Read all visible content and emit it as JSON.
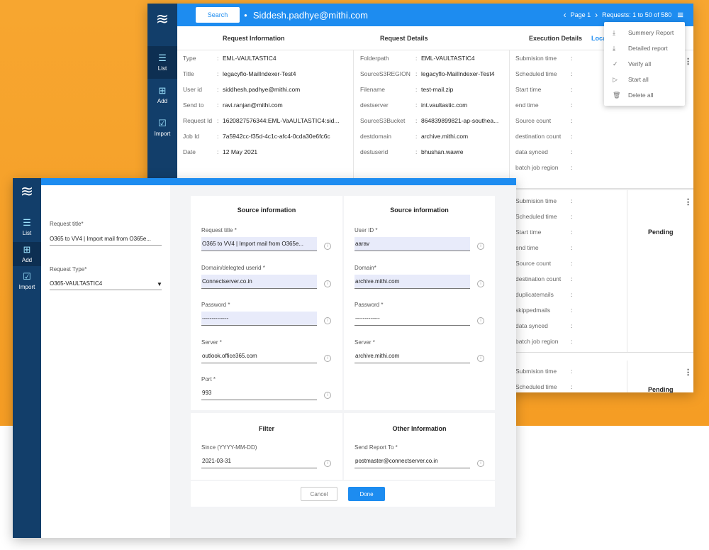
{
  "back": {
    "nav": [
      {
        "label": "List",
        "icon": "list-icon"
      },
      {
        "label": "Add",
        "icon": "add-icon"
      },
      {
        "label": "Import",
        "icon": "import-icon"
      }
    ],
    "search_label": "Search",
    "user_email": "Siddesh.padhye@mithi.com",
    "pager": {
      "page": "Page 1",
      "requests": "Requests: 1 to 50 of 580"
    },
    "headers": {
      "request_info": "Request Information",
      "request_details": "Request Details",
      "execution_details": "Execution Details",
      "cut": "Loca"
    },
    "request_info": [
      {
        "k": "Type",
        "v": "EML-VAULTASTIC4"
      },
      {
        "k": "Title",
        "v": "legacyflo-MailIndexer-Test4"
      },
      {
        "k": "User id",
        "v": "siddhesh.padhye@mithi.com"
      },
      {
        "k": "Send to",
        "v": "ravi.ranjan@mithi.com"
      },
      {
        "k": "Request Id",
        "v": "1620827576344:EML-VaAULTASTIC4:sid..."
      },
      {
        "k": "Job Id",
        "v": "7a5942cc-f35d-4c1c-afc4-0cda30e6fc6c"
      },
      {
        "k": "Date",
        "v": "12 May 2021"
      }
    ],
    "request_details": [
      {
        "k": "Folderpath",
        "v": "EML-VAULTASTIC4"
      },
      {
        "k": "SourceS3REGION",
        "v": "legacyflo-MailIndexer-Test4"
      },
      {
        "k": "Filename",
        "v": "test-mail.zip"
      },
      {
        "k": "destserver",
        "v": "int.vaultastic.com"
      },
      {
        "k": "SourceS3Bucket",
        "v": "864839899821-ap-southea..."
      },
      {
        "k": "destdomain",
        "v": "archive.mithi.com"
      },
      {
        "k": "destuserid",
        "v": "bhushan.wawre"
      }
    ],
    "exec1": [
      "Submision time",
      "Scheduled time",
      "Start time",
      "end time",
      "Source count",
      "destination count",
      "data synced",
      "batch job region"
    ],
    "exec2": [
      "Submision time",
      "Scheduled time",
      "Start time",
      "end time",
      "Source count",
      "destination count",
      "duplicatemails",
      "skippedmails",
      "data synced",
      "batch job region"
    ],
    "exec3": [
      "Submision time",
      "Scheduled time"
    ],
    "status2": "Pending",
    "status3": "Pending",
    "menu": [
      {
        "label": "Summery Report",
        "icon": "download-icon"
      },
      {
        "label": "Detailed report",
        "icon": "download-icon"
      },
      {
        "label": "Verify all",
        "icon": "check-circle-icon"
      },
      {
        "label": "Start all",
        "icon": "play-icon"
      },
      {
        "label": "Delete all",
        "icon": "trash-icon"
      }
    ]
  },
  "front": {
    "nav": [
      {
        "label": "List",
        "icon": "list-icon"
      },
      {
        "label": "Add",
        "icon": "add-icon"
      },
      {
        "label": "Import",
        "icon": "import-icon"
      }
    ],
    "request_title_label": "Request title*",
    "request_title_value": "O365 to VV4 | Import mail from O365e...",
    "request_type_label": "Request Type*",
    "request_type_value": "O365-VAULTASTIC4",
    "source1": {
      "title": "Source information",
      "fields": [
        {
          "label": "Request title *",
          "value": "O365 to VV4 | Import mail from O365e..."
        },
        {
          "label": "Domain/delegted userid *",
          "value": "Connectserver.co.in"
        },
        {
          "label": "Password *",
          "value": "--------------"
        },
        {
          "label": "Server *",
          "value": "outlook.office365.com"
        },
        {
          "label": "Port *",
          "value": "993"
        }
      ]
    },
    "source2": {
      "title": "Source information",
      "fields": [
        {
          "label": "User ID *",
          "value": "aarav"
        },
        {
          "label": "Domain*",
          "value": "archive.mithi.com"
        },
        {
          "label": "Password *",
          "value": "-------------"
        },
        {
          "label": "Server *",
          "value": "archive.mithi.com"
        }
      ]
    },
    "filter": {
      "title": "Filter",
      "label": "Since (YYYY-MM-DD)",
      "value": "2021-03-31"
    },
    "other": {
      "title": "Other Information",
      "label": "Send Report To *",
      "value": "postmaster@connectserver.co.in"
    },
    "cancel": "Cancel",
    "done": "Done"
  }
}
